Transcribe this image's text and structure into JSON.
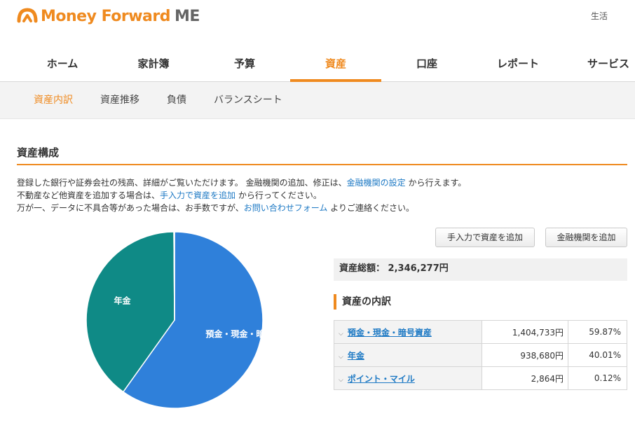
{
  "header": {
    "logo_text": "Money Forward",
    "logo_suffix": "ME",
    "link": "生活"
  },
  "gnav": [
    {
      "label": "ホーム"
    },
    {
      "label": "家計簿"
    },
    {
      "label": "予算"
    },
    {
      "label": "資産",
      "active": true
    },
    {
      "label": "口座"
    },
    {
      "label": "レポート"
    },
    {
      "label": "サービス"
    }
  ],
  "subnav": [
    {
      "label": "資産内訳",
      "active": true
    },
    {
      "label": "資産推移"
    },
    {
      "label": "負債"
    },
    {
      "label": "バランスシート"
    }
  ],
  "section_title": "資産構成",
  "description": {
    "line1_a": "登録した銀行や証券会社の残高、詳細がご覧いただけます。 金融機関の追加、修正は、",
    "line1_link": "金融機関の設定",
    "line1_b": " から行えます。",
    "line2_a": "不動産など他資産を追加する場合は、",
    "line2_link": "手入力で資産を追加",
    "line2_b": " から行ってください。",
    "line3_a": "万が一、データに不具合等があった場合は、お手数ですが、",
    "line3_link": "お問い合わせフォーム",
    "line3_b": " よりご連絡ください。"
  },
  "buttons": {
    "manual_add": "手入力で資産を追加",
    "institution_add": "金融機関を追加"
  },
  "total": {
    "label": "資産総額：",
    "value": "2,346,277円"
  },
  "breakdown_title": "資産の内訳",
  "breakdown": [
    {
      "name": "預金・現金・暗号資産",
      "amount": "1,404,733円",
      "percent": "59.87%"
    },
    {
      "name": "年金",
      "amount": "938,680円",
      "percent": "40.01%"
    },
    {
      "name": "ポイント・マイル",
      "amount": "2,864円",
      "percent": "0.12%"
    }
  ],
  "chart_data": {
    "type": "pie",
    "slices": [
      {
        "label": "預金・現金・暗号資産",
        "value": 59.87,
        "color": "#2f80da",
        "show_label": "預金・現金・暗号"
      },
      {
        "label": "年金",
        "value": 40.01,
        "color": "#0f8a86",
        "show_label": "年金"
      },
      {
        "label": "ポイント・マイル",
        "value": 0.12,
        "color": "#f2c343",
        "show_label": ""
      }
    ]
  },
  "colors": {
    "accent": "#ef8a1f",
    "link": "#1d79c4"
  }
}
